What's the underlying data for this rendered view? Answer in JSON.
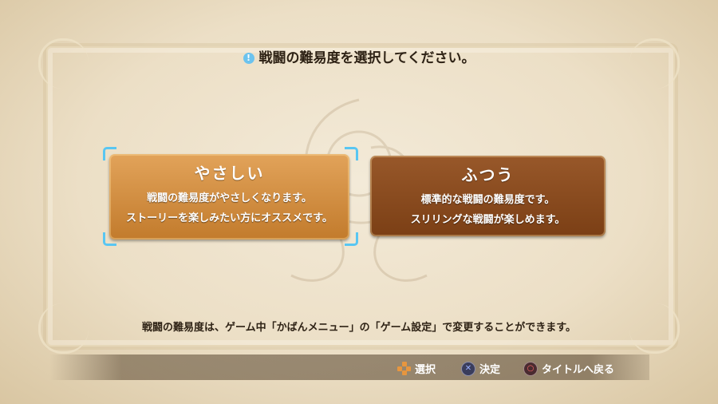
{
  "header": {
    "prompt": "戦闘の難易度を選択してください。",
    "icon": "exclamation-icon"
  },
  "options": [
    {
      "title": "やさしい",
      "line1": "戦闘の難易度がやさしくなります。",
      "line2": "ストーリーを楽しみたい方にオススメです。",
      "selected": true
    },
    {
      "title": "ふつう",
      "line1": "標準的な戦闘の難易度です。",
      "line2": "スリリングな戦闘が楽しめます。",
      "selected": false
    }
  ],
  "note": "戦闘の難易度は、ゲーム中「かばんメニュー」の「ゲーム設定」で変更することができます。",
  "controls": [
    {
      "icon": "dpad-icon",
      "label": "選択"
    },
    {
      "icon": "cross-button-icon",
      "label": "決定"
    },
    {
      "icon": "circle-button-icon",
      "label": "タイトルへ戻る"
    }
  ],
  "colors": {
    "selection": "#59c6f2",
    "easy_card": "#c27b2c",
    "normal_card": "#7b3f15"
  }
}
